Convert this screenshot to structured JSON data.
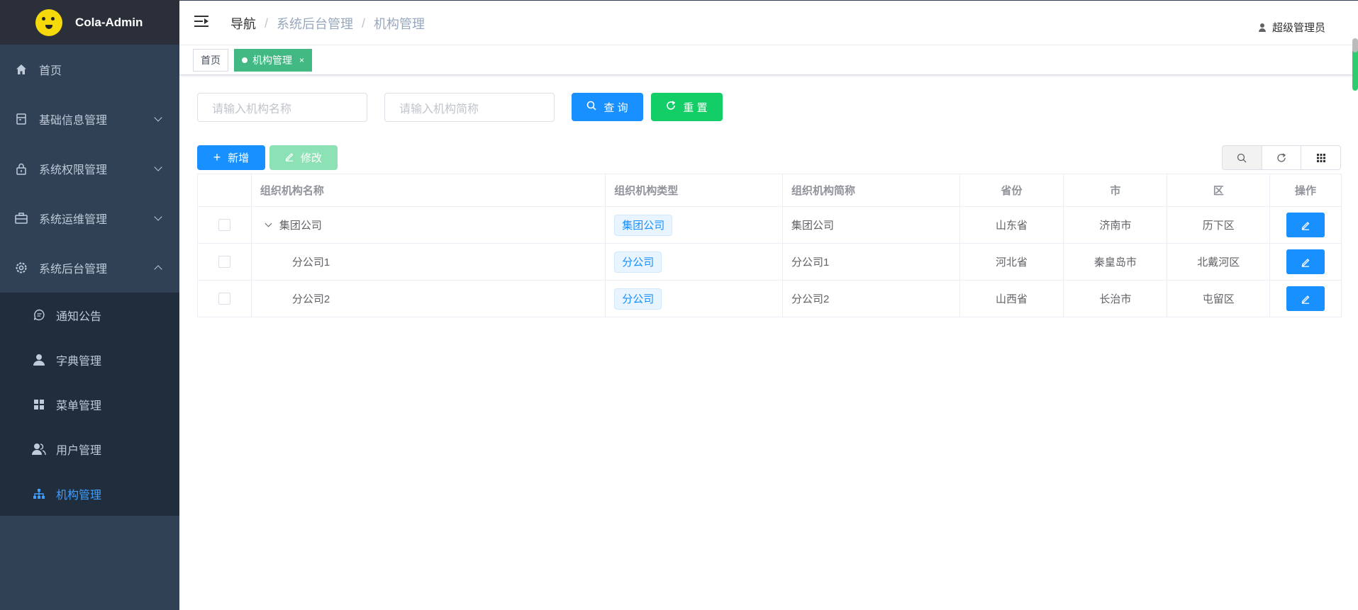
{
  "app": {
    "title": "Cola-Admin"
  },
  "sidebar": {
    "items": [
      {
        "label": "首页",
        "icon": "home-icon"
      },
      {
        "label": "基础信息管理",
        "icon": "document-icon"
      },
      {
        "label": "系统权限管理",
        "icon": "lock-icon"
      },
      {
        "label": "系统运维管理",
        "icon": "toolbox-icon"
      },
      {
        "label": "系统后台管理",
        "icon": "gear-icon"
      }
    ],
    "subitems": [
      {
        "label": "通知公告",
        "icon": "message-icon"
      },
      {
        "label": "字典管理",
        "icon": "user-icon"
      },
      {
        "label": "菜单管理",
        "icon": "grid-icon"
      },
      {
        "label": "用户管理",
        "icon": "users-icon"
      },
      {
        "label": "机构管理",
        "icon": "tree-icon"
      }
    ]
  },
  "header": {
    "breadcrumb": [
      "导航",
      "系统后台管理",
      "机构管理"
    ],
    "user": "超级管理员"
  },
  "tags": {
    "home": "首页",
    "active": "机构管理",
    "close": "×"
  },
  "search": {
    "name_placeholder": "请输入机构名称",
    "short_placeholder": "请输入机构简称",
    "query_label": "查 询",
    "reset_label": "重 置"
  },
  "toolbar": {
    "add_label": "新增",
    "edit_label": "修改"
  },
  "table": {
    "columns": [
      "组织机构名称",
      "组织机构类型",
      "组织机构简称",
      "省份",
      "市",
      "区",
      "操作"
    ],
    "rows": [
      {
        "name": "集团公司",
        "type": "集团公司",
        "short": "集团公司",
        "province": "山东省",
        "city": "济南市",
        "district": "历下区"
      },
      {
        "name": "分公司1",
        "type": "分公司",
        "short": "分公司1",
        "province": "河北省",
        "city": "秦皇岛市",
        "district": "北戴河区"
      },
      {
        "name": "分公司2",
        "type": "分公司",
        "short": "分公司2",
        "province": "山西省",
        "city": "长治市",
        "district": "屯留区"
      }
    ]
  },
  "colors": {
    "primary": "#1890ff",
    "success": "#13ce66",
    "sidebar": "#304156",
    "tag_active": "#42b983"
  }
}
